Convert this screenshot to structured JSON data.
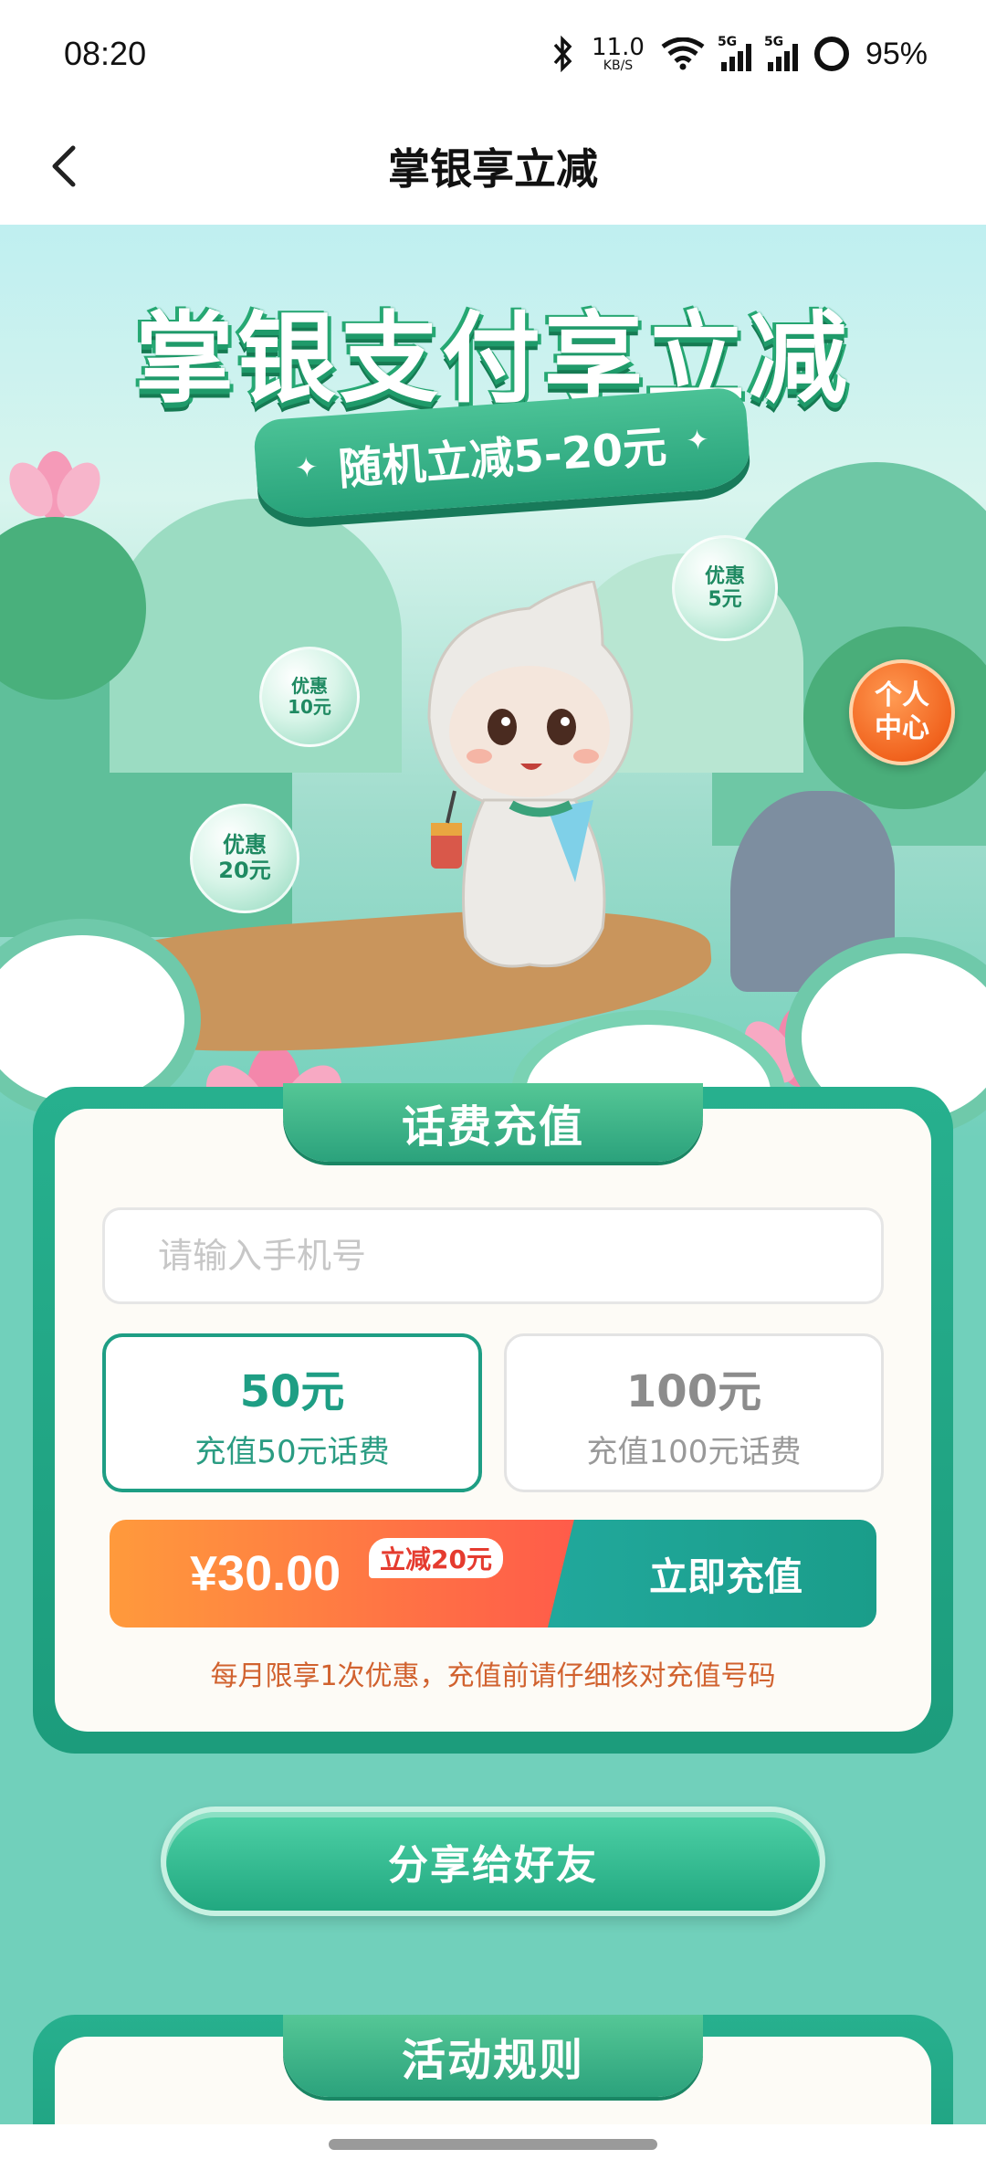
{
  "status_bar": {
    "time": "08:20",
    "net_speed_value": "11.0",
    "net_speed_unit": "KB/S",
    "signal1_tag": "5G",
    "signal2_tag": "5G",
    "battery": "95%"
  },
  "nav": {
    "title": "掌银享立减"
  },
  "hero": {
    "title": "掌银支付享立减",
    "ribbon_text": "随机立减5-20元",
    "bubbles": [
      {
        "line1": "优惠",
        "line2": "5元"
      },
      {
        "line1": "优惠",
        "line2": "10元"
      },
      {
        "line1": "优惠",
        "line2": "20元"
      }
    ],
    "personal_center": {
      "line1": "个人",
      "line2": "中心"
    }
  },
  "recharge": {
    "section_title": "话费充值",
    "phone_placeholder": "请输入手机号",
    "options": [
      {
        "amount": "50元",
        "desc": "充值50元话费",
        "selected": true
      },
      {
        "amount": "100元",
        "desc": "充值100元话费",
        "selected": false
      }
    ],
    "price": "¥30.00",
    "discount_badge": "立减20元",
    "pay_button": "立即充值",
    "notice": "每月限享1次优惠，充值前请仔细核对充值号码"
  },
  "share_button": "分享给好友",
  "rules": {
    "section_title": "活动规则"
  },
  "colors": {
    "accent_green": "#1e9e84",
    "orange": "#ff9a3c",
    "notice": "#d1622f"
  }
}
